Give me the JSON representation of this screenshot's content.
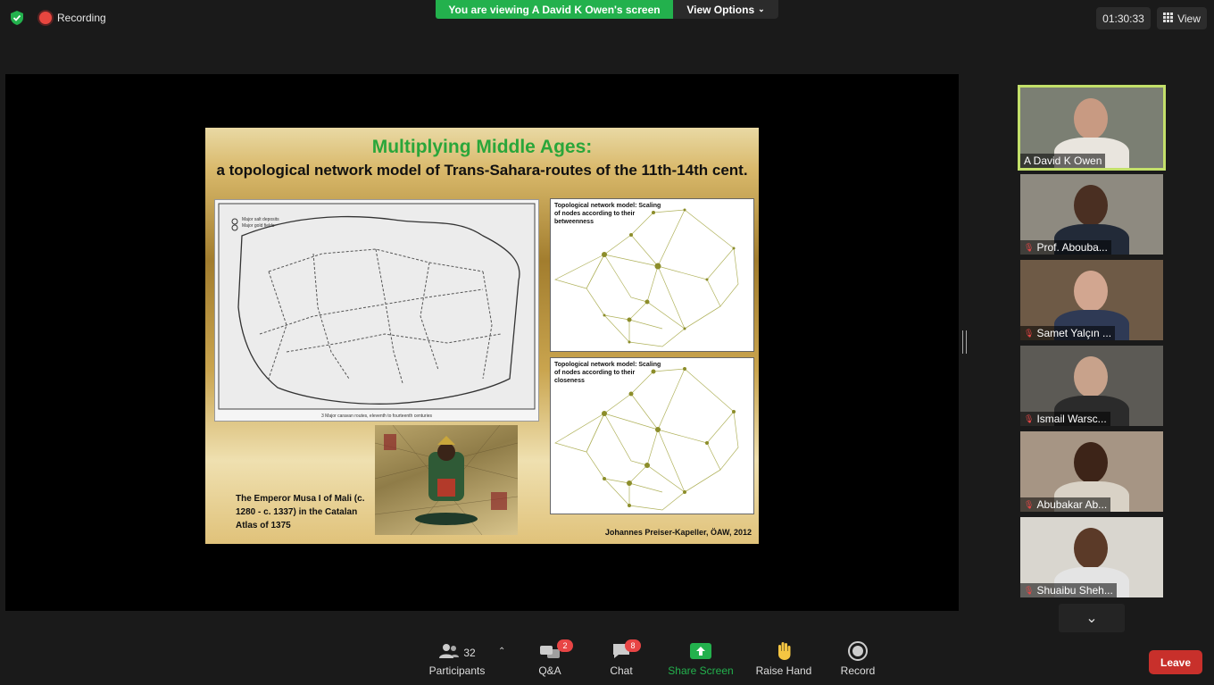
{
  "topbar": {
    "recording_label": "Recording",
    "viewing_banner": "You are viewing A David K Owen's screen",
    "view_options_label": "View Options",
    "timer": "01:30:33",
    "view_label": "View"
  },
  "slide": {
    "title": "Multiplying Middle Ages:",
    "subtitle": "a topological network model of Trans-Sahara-routes of the 11th-14th cent.",
    "map_caption": "3  Major caravan routes, eleventh to fourteenth centuries",
    "map_legend": [
      "Major salt deposits",
      "Major gold fields"
    ],
    "network_panel_1_label": "Topological network model: Scaling of nodes according to their betweenness",
    "network_panel_2_label": "Topological network model: Scaling of nodes according to their closeness",
    "caption": "The Emperor Musa I of Mali (c. 1280 - c. 1337) in the Catalan Atlas of 1375",
    "credit": "Johannes Preiser-Kapeller, ÖAW, 2012"
  },
  "participants_tiles": [
    {
      "name": "A David K Owen",
      "muted": false,
      "active": true,
      "bg": "#7b7f73",
      "skin": "#c89a82",
      "shirt": "#e9e5de"
    },
    {
      "name": "Prof. Abouba...",
      "muted": true,
      "active": false,
      "bg": "#8e8a80",
      "skin": "#4a2f22",
      "shirt": "#222a38"
    },
    {
      "name": "Samet Yalçın ...",
      "muted": true,
      "active": false,
      "bg": "#6e5a46",
      "skin": "#d2a690",
      "shirt": "#2f3a55"
    },
    {
      "name": "Ismail Warsc...",
      "muted": true,
      "active": false,
      "bg": "#5c5a55",
      "skin": "#c8a28b",
      "shirt": "#2b2b2b"
    },
    {
      "name": "Abubakar Ab...",
      "muted": true,
      "active": false,
      "bg": "#a69584",
      "skin": "#3d2418",
      "shirt": "#d9d2c6"
    },
    {
      "name": "Shuaibu Sheh...",
      "muted": true,
      "active": false,
      "bg": "#d9d6cf",
      "skin": "#5b3a28",
      "shirt": "#e4e4e4"
    }
  ],
  "toolbar": {
    "participants_label": "Participants",
    "participants_count": "32",
    "qa_label": "Q&A",
    "qa_badge": "2",
    "chat_label": "Chat",
    "chat_badge": "8",
    "share_label": "Share Screen",
    "raise_hand_label": "Raise Hand",
    "record_label": "Record",
    "leave_label": "Leave"
  },
  "colors": {
    "share_green": "#23b14d",
    "active_speaker_border": "#c3e06a",
    "leave_red": "#c8302b",
    "badge_red": "#e84545"
  }
}
